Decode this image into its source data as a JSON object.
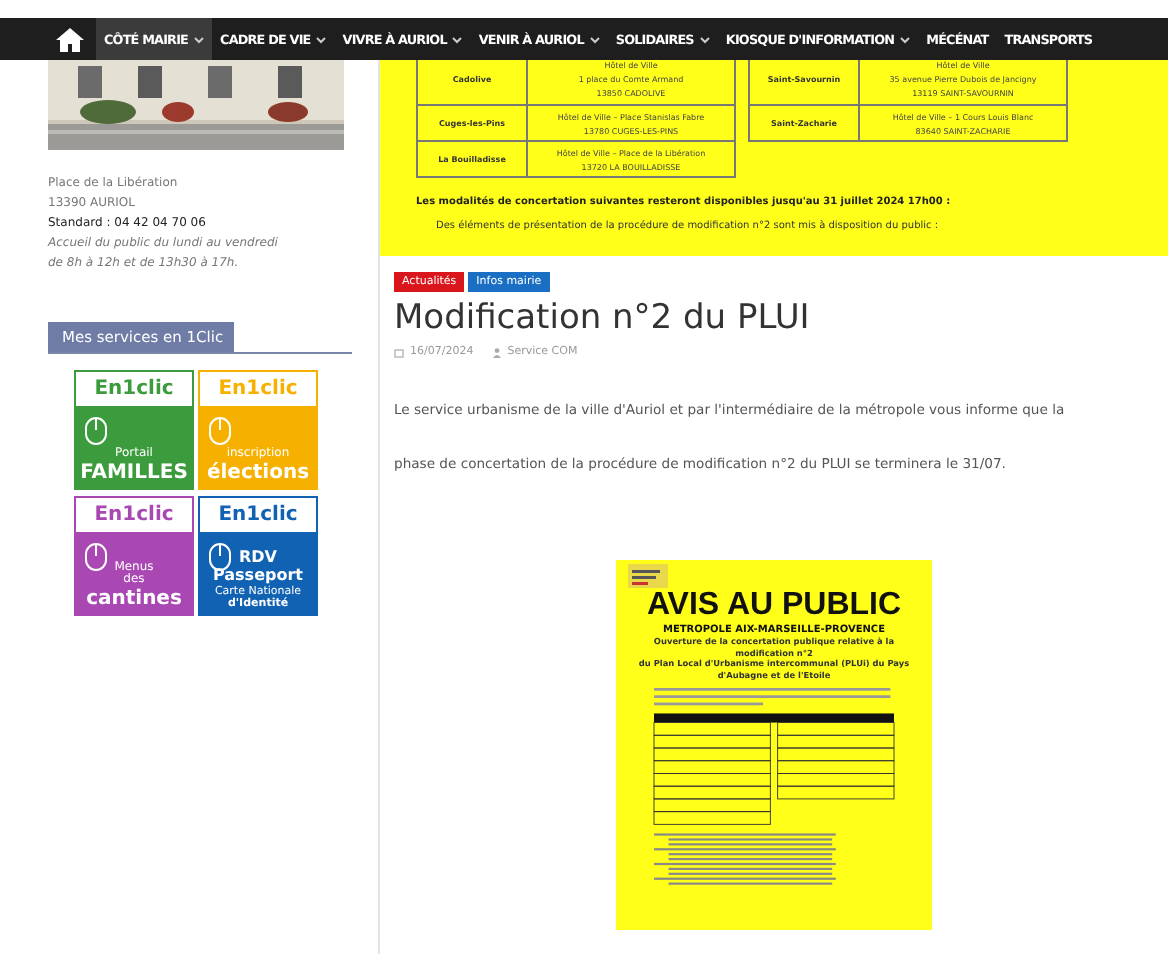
{
  "nav": {
    "items": [
      {
        "label": "CÔTÉ MAIRIE",
        "selected": true,
        "dropdown": true
      },
      {
        "label": "CADRE DE VIE",
        "selected": false,
        "dropdown": true
      },
      {
        "label": "VIVRE À AURIOL",
        "selected": false,
        "dropdown": true
      },
      {
        "label": "VENIR À AURIOL",
        "selected": false,
        "dropdown": true
      },
      {
        "label": "SOLIDAIRES",
        "selected": false,
        "dropdown": true
      },
      {
        "label": "KIOSQUE D'INFORMATION",
        "selected": false,
        "dropdown": true
      },
      {
        "label": "MÉCÉNAT",
        "selected": false,
        "dropdown": false
      },
      {
        "label": "TRANSPORTS",
        "selected": false,
        "dropdown": false
      }
    ]
  },
  "sidebar": {
    "photo": {
      "kind": "picture"
    },
    "address": [
      "Place de la Libération",
      "13390 AURIOL"
    ],
    "phone": "Standard : 04 42 04 70 06",
    "hours": [
      "Accueil du public du lundi au vendredi",
      "de 8h à 12h et de 13h30 à 17h."
    ],
    "services_title": "Mes services en 1Clic",
    "tiles": [
      {
        "brand": "En1clic",
        "lines": [
          "Portail",
          "FAMILLES"
        ],
        "color": "#3c9b3c"
      },
      {
        "brand": "En1clic",
        "lines": [
          "inscription",
          "élections"
        ],
        "color": "#f6b100"
      },
      {
        "brand": "En1clic",
        "lines": [
          "Menus",
          "des",
          "cantines"
        ],
        "color": "#a947b3"
      },
      {
        "brand": "En1clic",
        "lines": [
          "RDV",
          "Passeport",
          "Carte Nationale",
          "d'Identité"
        ],
        "color": "#1262b3"
      }
    ]
  },
  "notice": {
    "rows": [
      [
        {
          "town": "Cadolive",
          "address": [
            "Hôtel de Ville",
            "1 place du Comte Armand",
            "13850 CADOLIVE"
          ]
        },
        {
          "town": "Saint-Savournin",
          "address": [
            "Hôtel de Ville",
            "35 avenue Pierre Dubois de Jancigny",
            "13119 SAINT-SAVOURNIN"
          ]
        }
      ],
      [
        {
          "town": "Cuges-les-Pins",
          "address": [
            "Hôtel de Ville – Place Stanislas Fabre",
            "13780 CUGES-LES-PINS"
          ]
        },
        {
          "town": "Saint-Zacharie",
          "address": [
            "Hôtel de Ville – 1 Cours Louis Blanc",
            "83640 SAINT-ZACHARIE"
          ]
        }
      ],
      [
        {
          "town": "La Bouilladisse",
          "address": [
            "Hôtel de Ville – Place de la Libération",
            "13720 LA BOUILLADISSE"
          ]
        }
      ]
    ],
    "deadline": "Les modalités de concertation suivantes resteront disponibles jusqu'au 31 juillet 2024 17h00 :",
    "intro": "Des éléments de présentation de la procédure de modification n°2 sont mis à disposition du public :"
  },
  "article": {
    "tags": [
      {
        "label": "Actualités",
        "color": "#d9161c"
      },
      {
        "label": "Infos mairie",
        "color": "#1a6fc4"
      }
    ],
    "title": "Modification n°2 du PLUI",
    "date": "16/07/2024",
    "author": "Service COM",
    "paragraphs": [
      "Le service urbanisme de la ville d'Auriol et par l'intermédiaire de la métropole vous informe que la",
      "phase de concertation de la procédure de modification n°2 du PLUI se terminera le 31/07."
    ],
    "poster": {
      "heading": "AVIS AU PUBLIC",
      "subheading": "METROPOLE AIX-MARSEILLE-PROVENCE",
      "lines": [
        "Ouverture de la concertation publique relative à la modification n°2",
        "du Plan Local d'Urbanisme intercommunal (PLUi) du Pays d'Aubagne et de l'Etoile"
      ]
    }
  }
}
